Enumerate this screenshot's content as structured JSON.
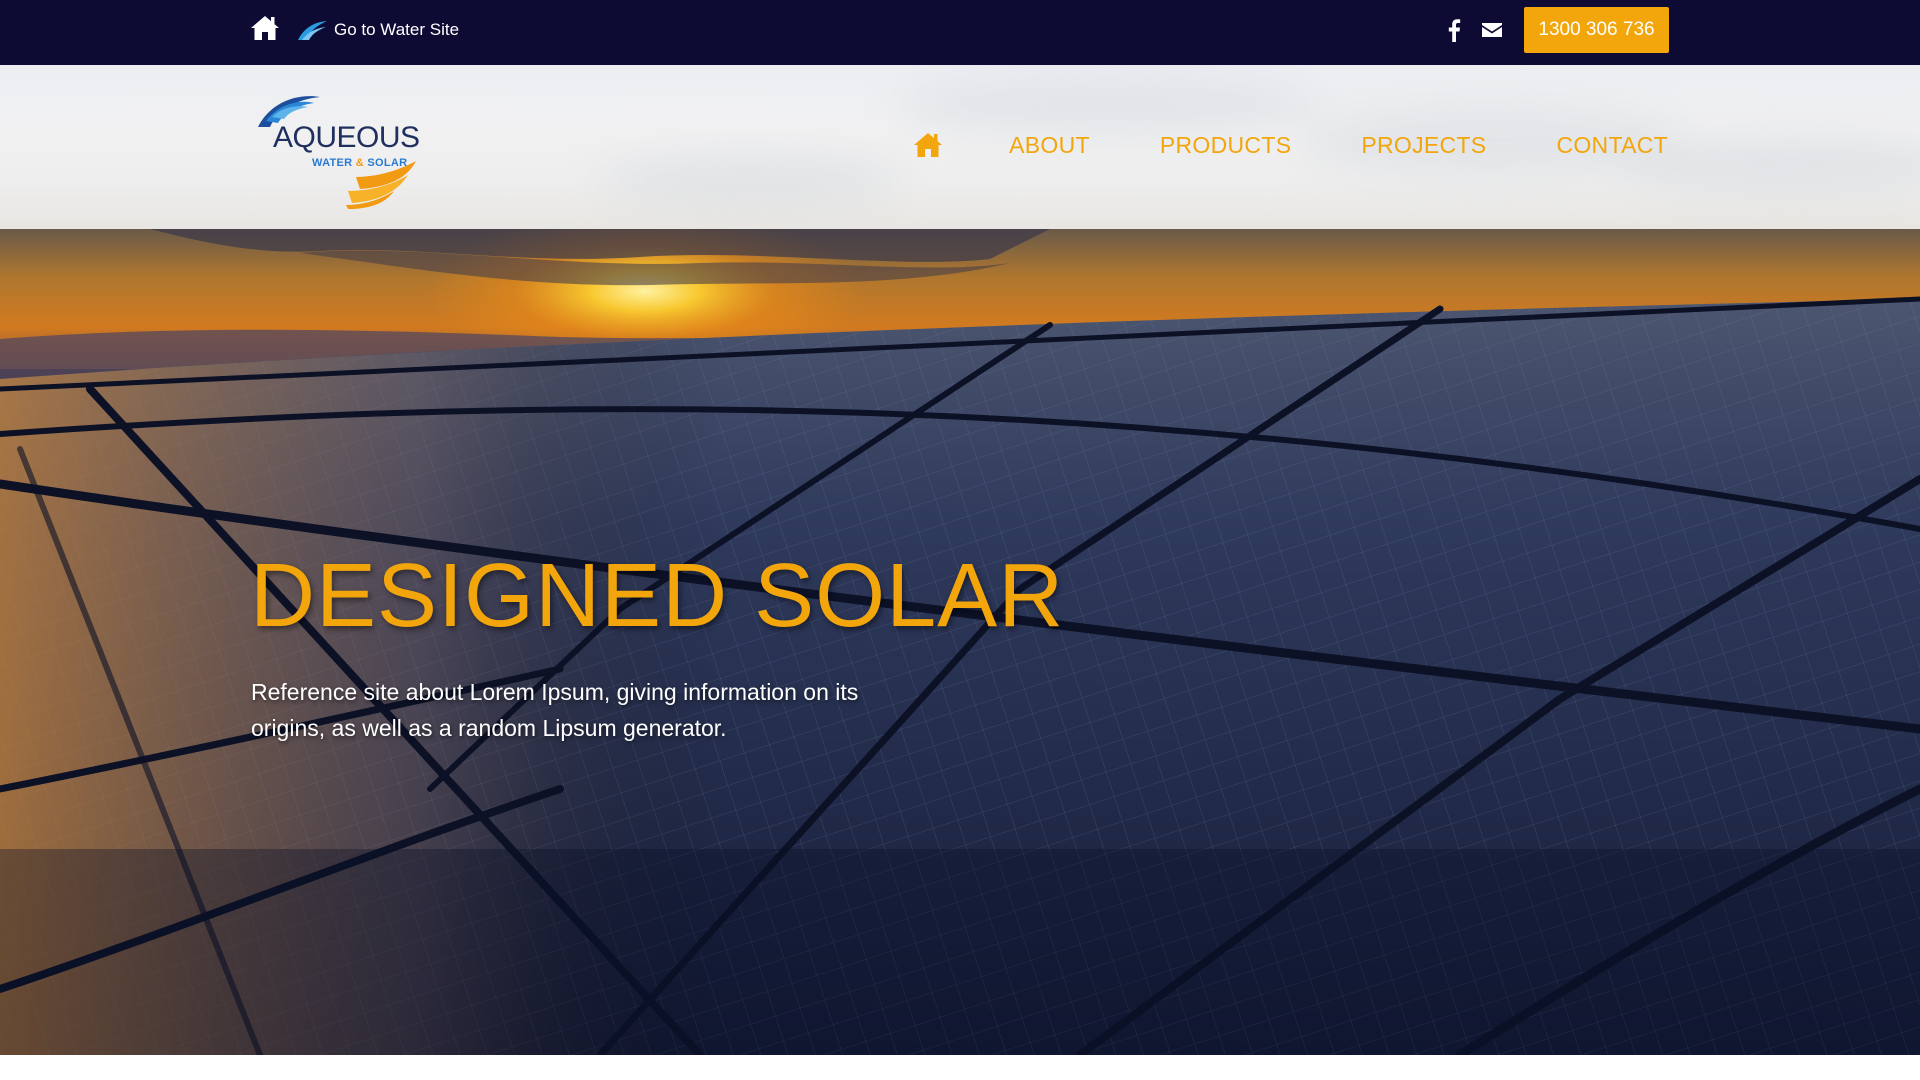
{
  "topbar": {
    "home_icon": "home-icon",
    "water_link_icon": "water-wave-icon",
    "water_link_label": "Go to Water Site",
    "facebook_icon": "facebook-icon",
    "email_icon": "envelope-icon",
    "phone_label": "1300 306 736"
  },
  "header": {
    "logo": {
      "word": "AQUEOUS",
      "sub_left": "WATER ",
      "sub_amp": "&",
      "sub_right": " SOLAR"
    },
    "nav": {
      "home_icon": "home-icon",
      "items": [
        {
          "label": "ABOUT"
        },
        {
          "label": "PRODUCTS"
        },
        {
          "label": "PROJECTS"
        },
        {
          "label": "CONTACT"
        }
      ]
    }
  },
  "hero": {
    "title": "DESIGNED SOLAR",
    "text": "Reference site about Lorem Ipsum, giving information on its origins, as well as a random Lipsum generator."
  },
  "colors": {
    "topbar_bg": "#0d0a33",
    "accent": "#f2a60c",
    "logo_text": "#1f2f5f",
    "logo_blue": "#2a7bd0"
  }
}
